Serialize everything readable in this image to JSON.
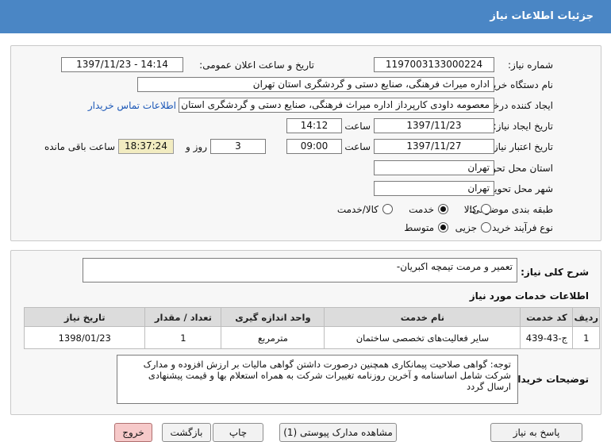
{
  "window": {
    "title": "جزئیات اطلاعات نیاز"
  },
  "details": {
    "need_number_label": "شماره نیاز:",
    "need_number": "1197003133000224",
    "announce_label": "تاریخ و ساعت اعلان عمومی:",
    "announce_value": "1397/11/23 - 14:14",
    "buyer_label": "نام دستگاه خریدار:",
    "buyer_value": "اداره میراث فرهنگی، صنایع دستی و گردشگری استان تهران",
    "creator_label": "ایجاد کننده درخواست:",
    "creator_value": "معصومه داودی کارپرداز اداره میراث فرهنگی، صنایع دستی و گردشگری استان تهران",
    "contact_link": "اطلاعات تماس خریدار",
    "created_label": "تاریخ ایجاد نیاز:",
    "created_date": "1397/11/23",
    "time_label": "ساعت",
    "created_time": "14:12",
    "valid_label": "تاریخ اعتبار نیاز:",
    "valid_date": "1397/11/27",
    "valid_time": "09:00",
    "days": "3",
    "days_label": "روز و",
    "remaining": "18:37:24",
    "remaining_label": "ساعت باقی مانده",
    "province_label": "استان محل تحویل:",
    "province": "تهران",
    "city_label": "شهر محل تحویل:",
    "city": "تهران",
    "category_label": "طبقه بندی موضوعی:",
    "category_options": [
      "کالا",
      "خدمت",
      "کالا/خدمت"
    ],
    "category_selected": "خدمت",
    "purchase_label": "نوع فرآیند خرید :",
    "purchase_options": [
      "جزیی",
      "متوسط"
    ],
    "purchase_selected": "متوسط"
  },
  "description": {
    "label": "شرح کلی نیاز:",
    "value": "تعمیر و مرمت تیمچه اکبریان-"
  },
  "services": {
    "title": "اطلاعات خدمات مورد نیاز",
    "columns": [
      "ردیف",
      "کد خدمت",
      "نام خدمت",
      "واحد اندازه گیری",
      "تعداد / مقدار",
      "تاریخ نیاز"
    ],
    "rows": [
      [
        "1",
        "ج-43-439",
        "سایر فعالیت‌های تخصصی ساختمان",
        "مترمربع",
        "1",
        "1398/01/23"
      ]
    ]
  },
  "notes": {
    "label": "توضیحات خریدار:",
    "text": "توجه: گواهی صلاحیت پیمانکاری همچنین درصورت داشتن گواهی مالیات بر ارزش افزوده و مدارک شرکت شامل اساسنامه و آخرین روزنامه تغییرات شرکت به همراه استعلام بها و قیمت پیشنهادی ارسال گردد"
  },
  "buttons": {
    "respond": "پاسخ به نیاز",
    "docs": "مشاهده مدارک پیوستی (1)",
    "print": "چاپ",
    "back": "بازگشت",
    "exit": "خروج"
  },
  "colors": {
    "titlebar": "#4a86c5",
    "link": "#1b57b7",
    "remaining_bg": "#f2ecc1"
  }
}
